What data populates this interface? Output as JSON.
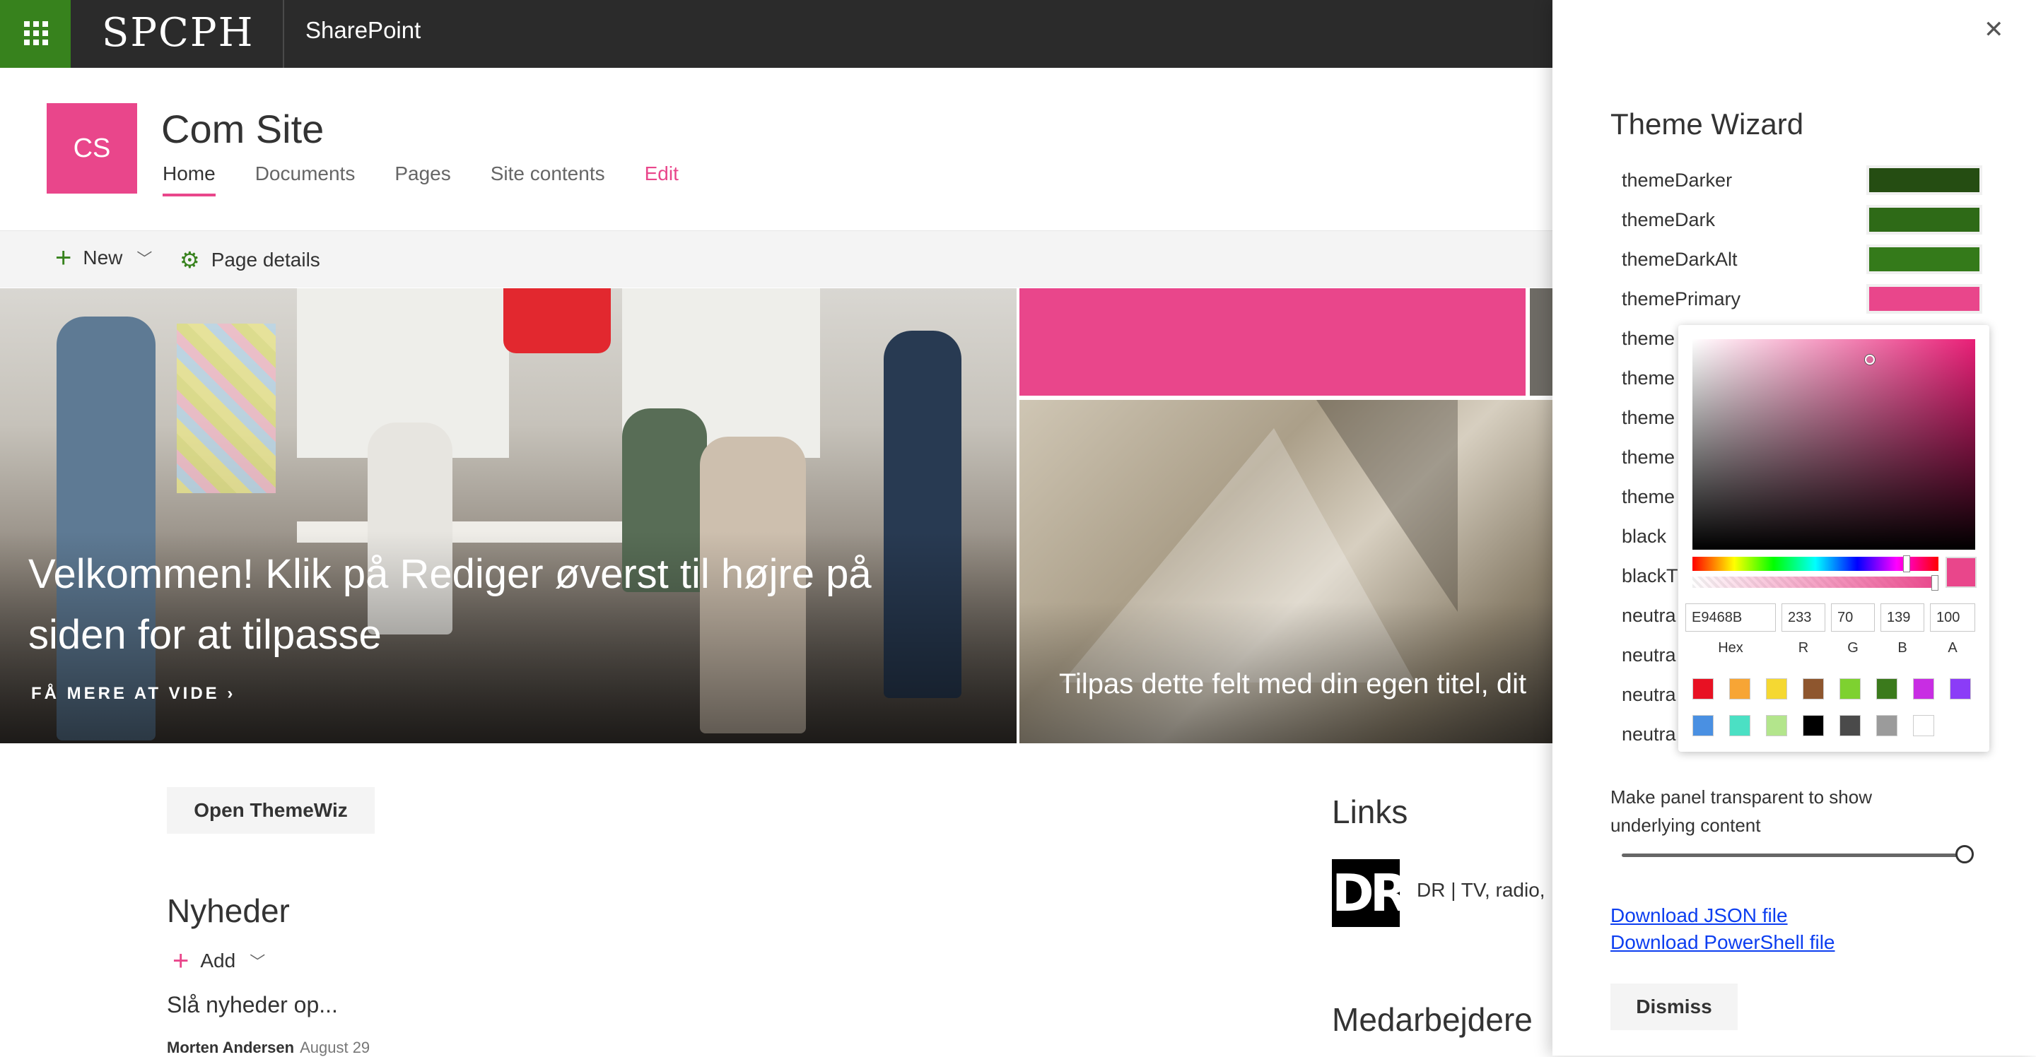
{
  "suitebar": {
    "logo": "SPCPH",
    "app_name": "SharePoint"
  },
  "site": {
    "logo_initials": "CS",
    "title": "Com Site",
    "nav": [
      {
        "label": "Home"
      },
      {
        "label": "Documents"
      },
      {
        "label": "Pages"
      },
      {
        "label": "Site contents"
      },
      {
        "label": "Edit"
      }
    ]
  },
  "commandbar": {
    "new_label": "New",
    "details_label": "Page details"
  },
  "hero": {
    "title": "Velkommen! Klik på Rediger øverst til højre på siden for at tilpasse",
    "more_label": "FÅ MERE AT VIDE",
    "tile_caption": "Tilpas dette felt med din egen titel, dit"
  },
  "content": {
    "open_button": "Open ThemeWiz",
    "news_heading": "Nyheder",
    "news_add": "Add",
    "news_item": "Slå nyheder op...",
    "news_author": "Morten Andersen",
    "news_date": "August 29",
    "links_heading": "Links",
    "link_logo": "DR",
    "link_text": "DR | TV, radio,",
    "staff_heading": "Medarbejdere"
  },
  "panel": {
    "title": "Theme Wizard",
    "close_glyph": "✕",
    "slots": [
      {
        "label": "themeDarker",
        "color": "#254d12"
      },
      {
        "label": "themeDark",
        "color": "#2e6a17"
      },
      {
        "label": "themeDarkAlt",
        "color": "#347a1a"
      },
      {
        "label": "themePrimary",
        "color": "#e9468b"
      },
      {
        "label": "theme",
        "color": ""
      },
      {
        "label": "theme",
        "color": ""
      },
      {
        "label": "theme",
        "color": ""
      },
      {
        "label": "theme",
        "color": ""
      },
      {
        "label": "theme",
        "color": ""
      },
      {
        "label": "black",
        "color": ""
      },
      {
        "label": "blackT",
        "color": ""
      },
      {
        "label": "neutra",
        "color": ""
      },
      {
        "label": "neutra",
        "color": ""
      },
      {
        "label": "neutra",
        "color": ""
      },
      {
        "label": "neutra",
        "color": ""
      }
    ],
    "picker": {
      "hex": "E9468B",
      "r": "233",
      "g": "70",
      "b": "139",
      "a": "100",
      "labels": {
        "hex": "Hex",
        "r": "R",
        "g": "G",
        "b": "B",
        "a": "A"
      },
      "swatches": [
        "#e81123",
        "#f7a535",
        "#f5d832",
        "#8e562e",
        "#7ed130",
        "#3b7a1c",
        "#c82de3",
        "#8b3cf7",
        "#4a90e2",
        "#4be0c4",
        "#b3e58c",
        "#000000",
        "#4a4a4a",
        "#9b9b9b",
        "#ffffff"
      ]
    },
    "transparent_label": "Make panel transparent to show underlying content",
    "transparency_value": 1,
    "download_json": "Download JSON file",
    "download_ps": "Download PowerShell file",
    "dismiss": "Dismiss"
  }
}
